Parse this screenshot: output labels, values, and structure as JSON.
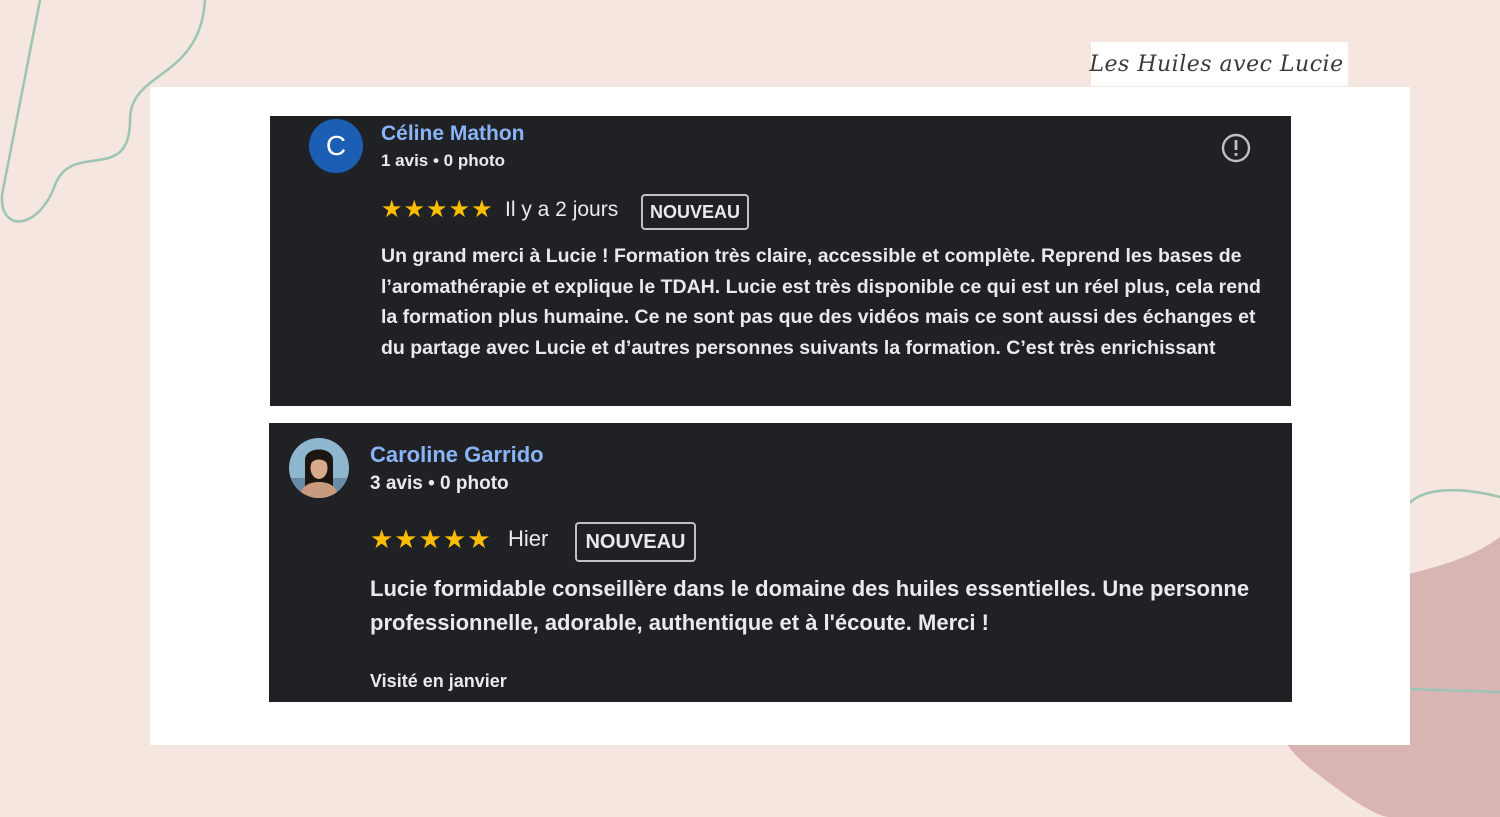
{
  "brand": {
    "name": "Les Huiles avec Lucie"
  },
  "reviews": [
    {
      "avatar_letter": "C",
      "author": "Céline Mathon",
      "meta": "1 avis • 0 photo",
      "stars": "★★★★★",
      "rating": 5,
      "time": "Il y a 2 jours",
      "badge": "NOUVEAU",
      "text": "Un grand merci à Lucie ! Formation très claire, accessible et complète. Reprend les bases de l’aromathérapie et explique le TDAH. Lucie est très disponible ce qui est un réel plus, cela rend la formation plus humaine. Ce ne sont pas que des vidéos mais ce sont aussi des échanges et du partage avec Lucie et d’autres personnes suivants la formation. C’est très enrichissant",
      "report_icon": "report-icon"
    },
    {
      "author": "Caroline Garrido",
      "meta": "3 avis • 0 photo",
      "stars": "★★★★★",
      "rating": 5,
      "time": "Hier",
      "badge": "NOUVEAU",
      "text": "Lucie formidable conseillère dans le domaine des huiles essentielles. Une personne professionnelle, adorable, authentique et à l'écoute. Merci !",
      "visited": "Visité en janvier"
    }
  ],
  "colors": {
    "background": "#f5e6df",
    "card": "#202124",
    "author_link": "#8ab4f8",
    "star": "#fbbc04",
    "avatar": "#1a5fb4",
    "decor_line": "#9cc5b3",
    "decor_blob": "#d8b4b2"
  }
}
